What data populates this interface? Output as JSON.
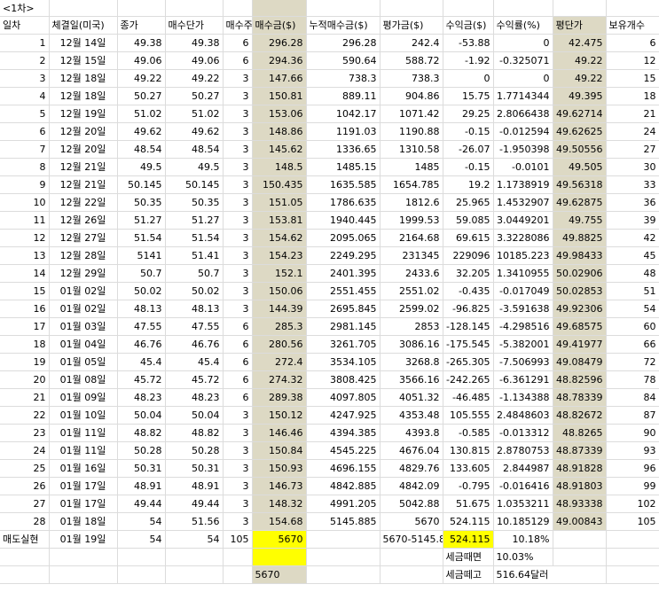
{
  "title": "<1차>",
  "headers": [
    "일차",
    "체결일(미국)",
    "종가",
    "매수단가",
    "매수주",
    "매수금($)",
    "누적매수금($)",
    "평가금($)",
    "수익금($)",
    "수익률(%)",
    "평단가",
    "보유개수"
  ],
  "rows": [
    [
      "1",
      "12월 14일",
      "49.38",
      "49.38",
      "6",
      "296.28",
      "296.28",
      "242.4",
      "-53.88",
      "0",
      "42.475",
      "6"
    ],
    [
      "2",
      "12월 15일",
      "49.06",
      "49.06",
      "6",
      "294.36",
      "590.64",
      "588.72",
      "-1.92",
      "-0.325071",
      "49.22",
      "12"
    ],
    [
      "3",
      "12월 18일",
      "49.22",
      "49.22",
      "3",
      "147.66",
      "738.3",
      "738.3",
      "0",
      "0",
      "49.22",
      "15"
    ],
    [
      "4",
      "12월 18일",
      "50.27",
      "50.27",
      "3",
      "150.81",
      "889.11",
      "904.86",
      "15.75",
      "1.7714344",
      "49.395",
      "18"
    ],
    [
      "5",
      "12월 19일",
      "51.02",
      "51.02",
      "3",
      "153.06",
      "1042.17",
      "1071.42",
      "29.25",
      "2.8066438",
      "49.62714",
      "21"
    ],
    [
      "6",
      "12월 20일",
      "49.62",
      "49.62",
      "3",
      "148.86",
      "1191.03",
      "1190.88",
      "-0.15",
      "-0.012594",
      "49.62625",
      "24"
    ],
    [
      "7",
      "12월 20일",
      "48.54",
      "48.54",
      "3",
      "145.62",
      "1336.65",
      "1310.58",
      "-26.07",
      "-1.950398",
      "49.50556",
      "27"
    ],
    [
      "8",
      "12월 21일",
      "49.5",
      "49.5",
      "3",
      "148.5",
      "1485.15",
      "1485",
      "-0.15",
      "-0.0101",
      "49.505",
      "30"
    ],
    [
      "9",
      "12월 21일",
      "50.145",
      "50.145",
      "3",
      "150.435",
      "1635.585",
      "1654.785",
      "19.2",
      "1.1738919",
      "49.56318",
      "33"
    ],
    [
      "10",
      "12월 22일",
      "50.35",
      "50.35",
      "3",
      "151.05",
      "1786.635",
      "1812.6",
      "25.965",
      "1.4532907",
      "49.62875",
      "36"
    ],
    [
      "11",
      "12월 26일",
      "51.27",
      "51.27",
      "3",
      "153.81",
      "1940.445",
      "1999.53",
      "59.085",
      "3.0449201",
      "49.755",
      "39"
    ],
    [
      "12",
      "12월 27일",
      "51.54",
      "51.54",
      "3",
      "154.62",
      "2095.065",
      "2164.68",
      "69.615",
      "3.3228086",
      "49.8825",
      "42"
    ],
    [
      "13",
      "12월 28일",
      "5141",
      "51.41",
      "3",
      "154.23",
      "2249.295",
      "231345",
      "229096",
      "10185.223",
      "49.98433",
      "45"
    ],
    [
      "14",
      "12월 29일",
      "50.7",
      "50.7",
      "3",
      "152.1",
      "2401.395",
      "2433.6",
      "32.205",
      "1.3410955",
      "50.02906",
      "48"
    ],
    [
      "15",
      "01월 02일",
      "50.02",
      "50.02",
      "3",
      "150.06",
      "2551.455",
      "2551.02",
      "-0.435",
      "-0.017049",
      "50.02853",
      "51"
    ],
    [
      "16",
      "01월 02일",
      "48.13",
      "48.13",
      "3",
      "144.39",
      "2695.845",
      "2599.02",
      "-96.825",
      "-3.591638",
      "49.92306",
      "54"
    ],
    [
      "17",
      "01월 03일",
      "47.55",
      "47.55",
      "6",
      "285.3",
      "2981.145",
      "2853",
      "-128.145",
      "-4.298516",
      "49.68575",
      "60"
    ],
    [
      "18",
      "01월 04일",
      "46.76",
      "46.76",
      "6",
      "280.56",
      "3261.705",
      "3086.16",
      "-175.545",
      "-5.382001",
      "49.41977",
      "66"
    ],
    [
      "19",
      "01월 05일",
      "45.4",
      "45.4",
      "6",
      "272.4",
      "3534.105",
      "3268.8",
      "-265.305",
      "-7.506993",
      "49.08479",
      "72"
    ],
    [
      "20",
      "01월 08일",
      "45.72",
      "45.72",
      "6",
      "274.32",
      "3808.425",
      "3566.16",
      "-242.265",
      "-6.361291",
      "48.82596",
      "78"
    ],
    [
      "21",
      "01월 09일",
      "48.23",
      "48.23",
      "6",
      "289.38",
      "4097.805",
      "4051.32",
      "-46.485",
      "-1.134388",
      "48.78339",
      "84"
    ],
    [
      "22",
      "01월 10일",
      "50.04",
      "50.04",
      "3",
      "150.12",
      "4247.925",
      "4353.48",
      "105.555",
      "2.4848603",
      "48.82672",
      "87"
    ],
    [
      "23",
      "01월 11일",
      "48.82",
      "48.82",
      "3",
      "146.46",
      "4394.385",
      "4393.8",
      "-0.585",
      "-0.013312",
      "48.8265",
      "90"
    ],
    [
      "24",
      "01월 11일",
      "50.28",
      "50.28",
      "3",
      "150.84",
      "4545.225",
      "4676.04",
      "130.815",
      "2.8780753",
      "48.87339",
      "93"
    ],
    [
      "25",
      "01월 16일",
      "50.31",
      "50.31",
      "3",
      "150.93",
      "4696.155",
      "4829.76",
      "133.605",
      "2.844987",
      "48.91828",
      "96"
    ],
    [
      "26",
      "01월 17일",
      "48.91",
      "48.91",
      "3",
      "146.73",
      "4842.885",
      "4842.09",
      "-0.795",
      "-0.016416",
      "48.91803",
      "99"
    ],
    [
      "27",
      "01월 17일",
      "49.44",
      "49.44",
      "3",
      "148.32",
      "4991.205",
      "5042.88",
      "51.675",
      "1.0353211",
      "48.93338",
      "102"
    ],
    [
      "28",
      "01월 18일",
      "54",
      "51.56",
      "3",
      "154.68",
      "5145.885",
      "5670",
      "524.115",
      "10.185129",
      "49.00843",
      "105"
    ]
  ],
  "sell_row": {
    "label": "매도실현",
    "date": "01월 19일",
    "close": "54",
    "price": "54",
    "qty": "105",
    "amount": "5670",
    "formula": "5670-5145.8",
    "profit": "524.115",
    "rate": "10.18%"
  },
  "tax_row1": {
    "label": "세금때면",
    "value": "10.03%"
  },
  "tax_row2": {
    "amount": "5670",
    "label": "세금떼고",
    "value": "516.64달러"
  },
  "colors": {
    "highlight_tan": "#ddd9c4",
    "highlight_yellow": "#ffff00",
    "grid": "#dcdcdc"
  }
}
